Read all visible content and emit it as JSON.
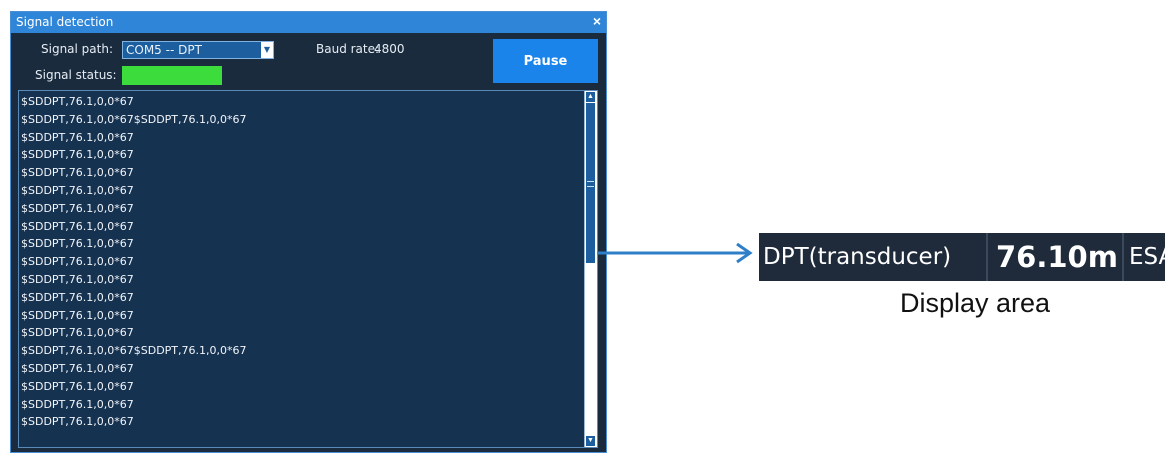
{
  "dialog": {
    "title": "Signal detection",
    "close_glyph": "×",
    "signal_path_label": "Signal path:",
    "signal_path_value": "COM5 -- DPT",
    "baud_label": "Baud rate:",
    "baud_value": "4800",
    "signal_status_label": "Signal status:",
    "signal_status_color": "#3ddc3d",
    "pause_label": "Pause",
    "log_lines": [
      "$SDDPT,76.1,0,0*67",
      "$SDDPT,76.1,0,0*67$SDDPT,76.1,0,0*67",
      "$SDDPT,76.1,0,0*67",
      "$SDDPT,76.1,0,0*67",
      "$SDDPT,76.1,0,0*67",
      "$SDDPT,76.1,0,0*67",
      "$SDDPT,76.1,0,0*67",
      "$SDDPT,76.1,0,0*67",
      "$SDDPT,76.1,0,0*67",
      "$SDDPT,76.1,0,0*67",
      "$SDDPT,76.1,0,0*67",
      "$SDDPT,76.1,0,0*67",
      "$SDDPT,76.1,0,0*67",
      "$SDDPT,76.1,0,0*67",
      "$SDDPT,76.1,0,0*67$SDDPT,76.1,0,0*67",
      "$SDDPT,76.1,0,0*67",
      "$SDDPT,76.1,0,0*67",
      "$SDDPT,76.1,0,0*67",
      "$SDDPT,76.1,0,0*67"
    ]
  },
  "display": {
    "name": "DPT(transducer)",
    "value": "76.10m",
    "unit": "ESA",
    "caption": "Display area"
  },
  "colors": {
    "dialog_bg": "#1a2b3d",
    "titlebar": "#2f86d9",
    "accent_button": "#1b84ea",
    "arrow": "#2f7fc8",
    "display_bg": "#1f2b3a"
  },
  "icons": {
    "dropdown": "chevron-down-icon",
    "close": "close-icon",
    "arrow": "arrow-right-icon"
  }
}
